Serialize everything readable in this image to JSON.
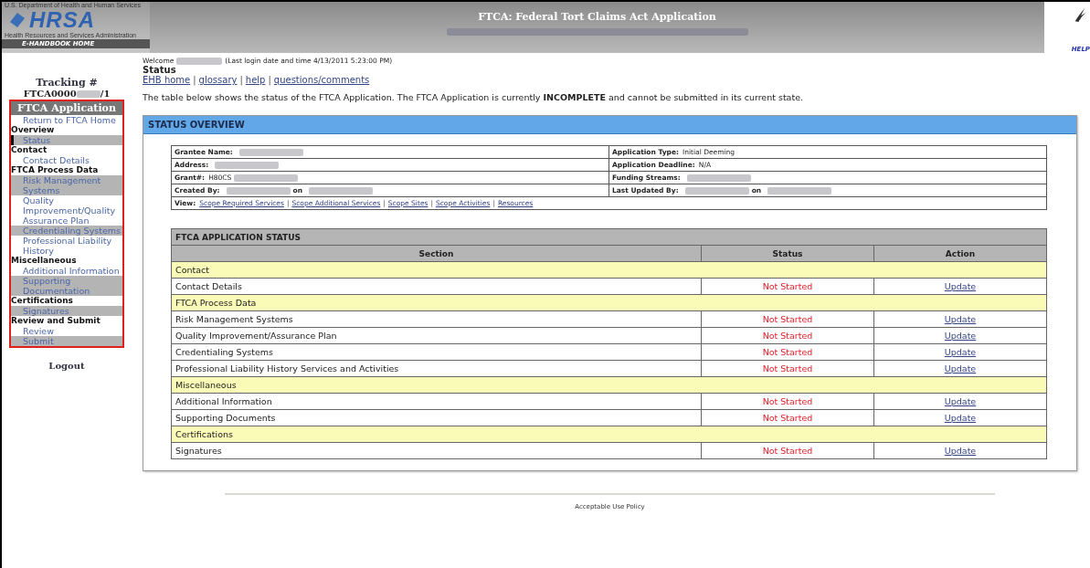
{
  "header": {
    "agency_line": "U.S. Department of Health and Human Services",
    "logo": "HRSA",
    "agency_name": "Health Resources and Services Administration",
    "home_tab": "E-HANDBOOK HOME",
    "title": "FTCA: Federal Tort Claims Act Application",
    "help": "HELP"
  },
  "sidebar": {
    "tracking_label": "Tracking #",
    "tracking_prefix": "FTCA0000",
    "tracking_suffix": "/1",
    "menu_title": "FTCA Application",
    "items": [
      {
        "kind": "link",
        "label": "Return to FTCA Home",
        "shaded": false,
        "selected": false
      },
      {
        "kind": "heading",
        "label": "Overview"
      },
      {
        "kind": "link",
        "label": "Status",
        "shaded": true,
        "selected": true
      },
      {
        "kind": "heading",
        "label": "Contact"
      },
      {
        "kind": "link",
        "label": "Contact Details",
        "shaded": false,
        "selected": false
      },
      {
        "kind": "heading",
        "label": "FTCA Process Data"
      },
      {
        "kind": "link",
        "label": "Risk Management Systems",
        "shaded": true,
        "selected": false
      },
      {
        "kind": "link",
        "label": "Quality Improvement/Quality Assurance Plan",
        "shaded": false,
        "selected": false
      },
      {
        "kind": "link",
        "label": "Credentialing Systems",
        "shaded": true,
        "selected": false
      },
      {
        "kind": "link",
        "label": "Professional Liability History",
        "shaded": false,
        "selected": false
      },
      {
        "kind": "heading",
        "label": "Miscellaneous"
      },
      {
        "kind": "link",
        "label": "Additional Information",
        "shaded": false,
        "selected": false
      },
      {
        "kind": "link",
        "label": "Supporting Documentation",
        "shaded": true,
        "selected": false
      },
      {
        "kind": "heading",
        "label": "Certifications"
      },
      {
        "kind": "link",
        "label": "Signatures",
        "shaded": true,
        "selected": false
      },
      {
        "kind": "heading",
        "label": "Review and Submit"
      },
      {
        "kind": "link",
        "label": "Review",
        "shaded": false,
        "selected": false
      },
      {
        "kind": "link",
        "label": "Submit",
        "shaded": true,
        "selected": false
      }
    ],
    "logout": "Logout"
  },
  "welcome": {
    "prefix": "Welcome",
    "last_login": "(Last login date and time 4/13/2011 5:23:00 PM)"
  },
  "page_title": "Status",
  "top_links": [
    "EHB home",
    "glossary",
    "help",
    "questions/comments"
  ],
  "link_separator": "|",
  "intro": "The table below shows the status of the FTCA Application. The FTCA Application is currently **INCOMPLETE** and cannot be submitted in its current state.",
  "overview": {
    "title": "STATUS OVERVIEW",
    "info_rows": [
      [
        {
          "label": "Grantee Name:",
          "parts": [
            {
              "kind": "redacted"
            }
          ]
        },
        {
          "label": "Application Type:",
          "parts": [
            {
              "kind": "text",
              "text": "Initial Deeming"
            }
          ]
        }
      ],
      [
        {
          "label": "Address:",
          "parts": [
            {
              "kind": "redacted"
            }
          ]
        },
        {
          "label": "Application Deadline:",
          "parts": [
            {
              "kind": "text",
              "text": "N/A"
            }
          ]
        }
      ],
      [
        {
          "label": "Grant#:",
          "parts": [
            {
              "kind": "text",
              "text": "H80CS"
            },
            {
              "kind": "redacted"
            }
          ]
        },
        {
          "label": "Funding Streams:",
          "parts": [
            {
              "kind": "redacted"
            }
          ]
        }
      ],
      [
        {
          "label": "Created By:",
          "parts": [
            {
              "kind": "redacted"
            },
            {
              "kind": "bold",
              "text": "on"
            },
            {
              "kind": "redacted"
            }
          ]
        },
        {
          "label": "Last Updated By:",
          "parts": [
            {
              "kind": "redacted"
            },
            {
              "kind": "bold",
              "text": "on"
            },
            {
              "kind": "redacted"
            }
          ]
        }
      ]
    ],
    "view_label": "View:",
    "view_links": [
      "Scope Required Services",
      "Scope Additional Services",
      "Scope Sites",
      "Scope Activities",
      "Resources"
    ]
  },
  "status_table": {
    "title": "FTCA APPLICATION STATUS",
    "columns": [
      "Section",
      "Status",
      "Action"
    ],
    "rows": [
      {
        "kind": "group",
        "section": "Contact"
      },
      {
        "kind": "item",
        "section": "Contact Details",
        "status": "Not Started",
        "action": "Update"
      },
      {
        "kind": "group",
        "section": "FTCA Process Data"
      },
      {
        "kind": "item",
        "section": "Risk Management Systems",
        "status": "Not Started",
        "action": "Update"
      },
      {
        "kind": "item",
        "section": "Quality Improvement/Assurance Plan",
        "status": "Not Started",
        "action": "Update"
      },
      {
        "kind": "item",
        "section": "Credentialing Systems",
        "status": "Not Started",
        "action": "Update"
      },
      {
        "kind": "item",
        "section": "Professional Liability History Services and Activities",
        "status": "Not Started",
        "action": "Update"
      },
      {
        "kind": "group",
        "section": "Miscellaneous"
      },
      {
        "kind": "item",
        "section": "Additional Information",
        "status": "Not Started",
        "action": "Update"
      },
      {
        "kind": "item",
        "section": "Supporting Documents",
        "status": "Not Started",
        "action": "Update"
      },
      {
        "kind": "group",
        "section": "Certifications"
      },
      {
        "kind": "item",
        "section": "Signatures",
        "status": "Not Started",
        "action": "Update"
      }
    ]
  },
  "footer": {
    "link": "Acceptable Use Policy"
  }
}
